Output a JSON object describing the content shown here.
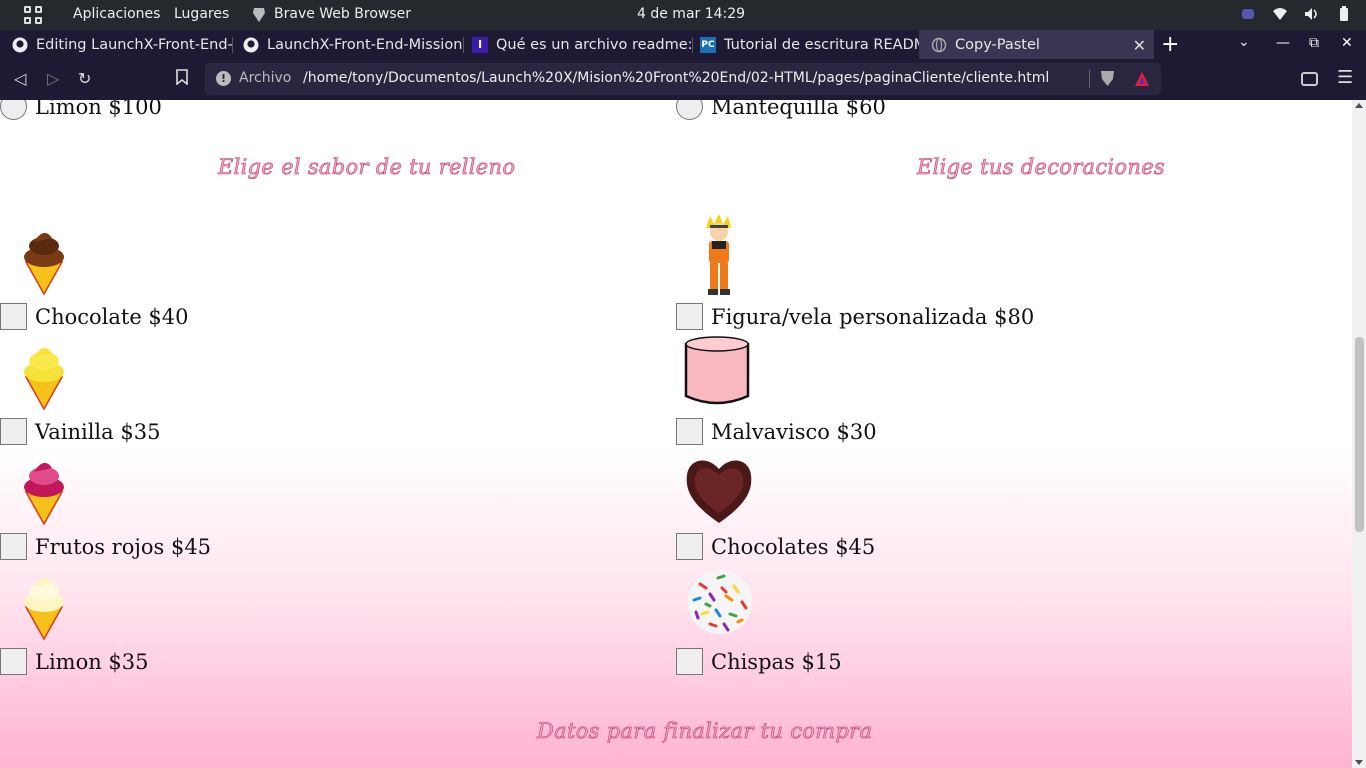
{
  "system_bar": {
    "applications": "Aplicaciones",
    "places": "Lugares",
    "app_name": "Brave Web Browser",
    "datetime": "4 de mar  14:29"
  },
  "tabs": [
    {
      "label": "Editing LaunchX-Front-End-",
      "icon": "github-icon"
    },
    {
      "label": "LaunchX-Front-End-Mission",
      "icon": "github-icon"
    },
    {
      "label": "Qué es un archivo readme: e",
      "icon": "site-favicon-i"
    },
    {
      "label": "Tutorial de escritura README",
      "icon": "site-favicon-pc"
    },
    {
      "label": "Copy-Pastel",
      "icon": "globe-icon",
      "active": true
    }
  ],
  "address_bar": {
    "scheme_label": "Archivo",
    "url": "/home/tony/Documentos/Launch%20X/Mision%20Front%20End/02-HTML/pages/paginaCliente/cliente.html"
  },
  "page": {
    "top_left_option": "Limon $100",
    "top_right_option": "Mantequilla $60",
    "filling_heading": "Elige el sabor de tu relleno",
    "decor_heading": "Elige tus decoraciones",
    "fillings": [
      {
        "label": "Chocolate $40",
        "image": "chocolate-icecream-image"
      },
      {
        "label": "Vainilla $35",
        "image": "vanilla-icecream-image"
      },
      {
        "label": "Frutos rojos $45",
        "image": "berries-icecream-image"
      },
      {
        "label": "Limon $35",
        "image": "lemon-icecream-image"
      }
    ],
    "decorations": [
      {
        "label": "Figura/vela personalizada $80",
        "image": "naruto-figure-image"
      },
      {
        "label": "Malvavisco $30",
        "image": "marshmallow-image"
      },
      {
        "label": "Chocolates $45",
        "image": "heart-chocolate-image"
      },
      {
        "label": "Chispas $15",
        "image": "sprinkles-image"
      }
    ],
    "checkout_heading": "Datos para finalizar tu compra"
  },
  "colors": {
    "heading_fill": "#f3a6c4",
    "heading_stroke": "#c23c6e",
    "gradient_bottom": "#ffb3d2",
    "browser_chrome": "#1e1a33"
  }
}
